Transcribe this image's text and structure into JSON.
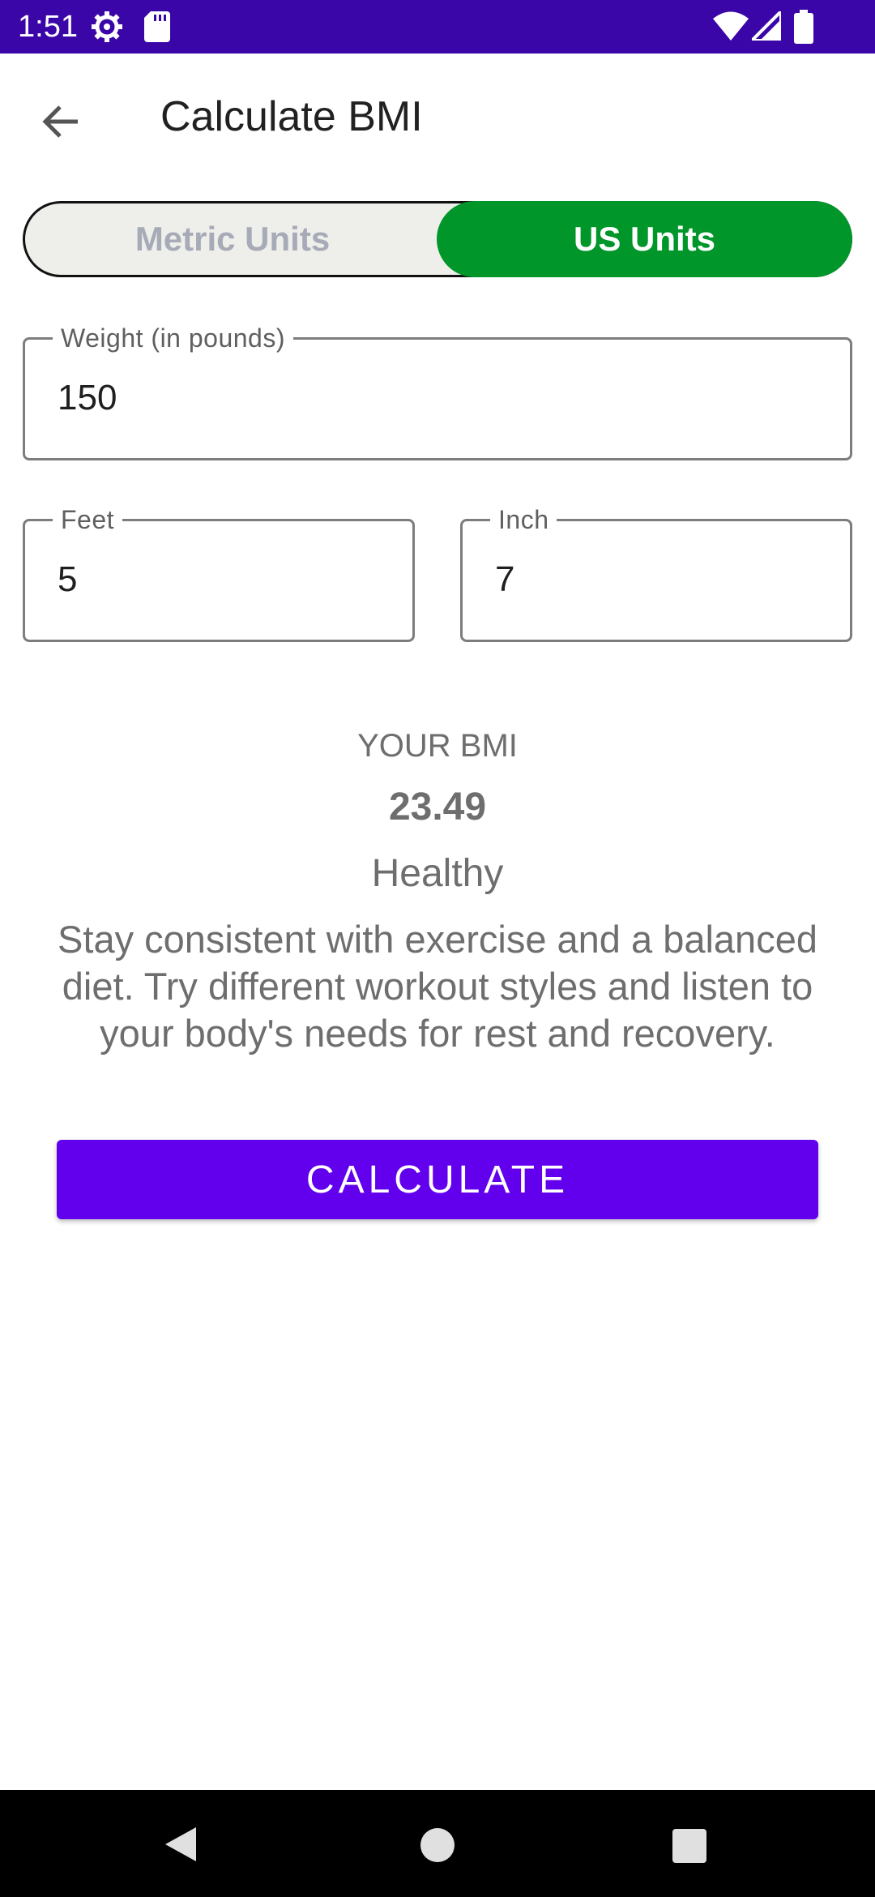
{
  "status_bar": {
    "time": "1:51",
    "icons": [
      "settings-icon",
      "sd-card-icon",
      "wifi-icon",
      "signal-icon",
      "battery-icon"
    ]
  },
  "app_bar": {
    "title": "Calculate BMI",
    "back_icon": "arrow-back-icon"
  },
  "unit_toggle": {
    "options": [
      "Metric Units",
      "US Units"
    ],
    "selected": "US Units",
    "selected_color": "#00962a"
  },
  "form": {
    "weight": {
      "label": "Weight (in pounds)",
      "value": "150"
    },
    "feet": {
      "label": "Feet",
      "value": "5"
    },
    "inch": {
      "label": "Inch",
      "value": "7"
    }
  },
  "result": {
    "heading": "YOUR BMI",
    "value": "23.49",
    "status": "Healthy",
    "advice": "Stay consistent with exercise and a balanced diet. Try different workout styles and listen to your body's needs for rest and recovery."
  },
  "calculate_button": {
    "label": "CALCULATE",
    "color": "#6200ee"
  },
  "nav_bar": {
    "icons": [
      "nav-back-icon",
      "nav-home-icon",
      "nav-recents-icon"
    ]
  }
}
